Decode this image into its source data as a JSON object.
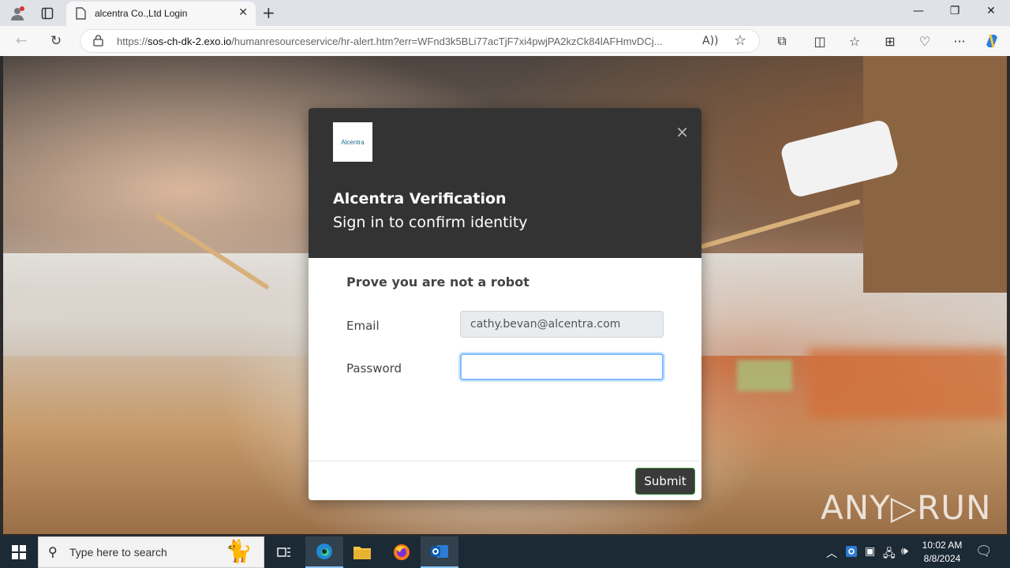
{
  "browser": {
    "tab_title": "alcentra Co.,Ltd Login",
    "url_scheme": "https://",
    "url_host": "sos-ch-dk-2.exo.io",
    "url_path": "/humanresourceservice/hr-alert.htm?err=WFnd3k5BLi77acTjF7xi4pwjPA2kzCk84lAFHmvDCj..."
  },
  "modal": {
    "logo_text": "Alcentra",
    "title": "Alcentra Verification",
    "subtitle": "Sign in to confirm identity",
    "prompt": "Prove you are not a robot",
    "email_label": "Email",
    "email_value": "cathy.bevan@alcentra.com",
    "password_label": "Password",
    "password_value": "",
    "submit_label": "Submit",
    "close_glyph": "×"
  },
  "watermark": "ANY▷RUN",
  "taskbar": {
    "search_placeholder": "Type here to search",
    "time": "10:02 AM",
    "date": "8/8/2024"
  },
  "colors": {
    "modal_header": "#333333",
    "input_focus_border": "#80bdff",
    "submit_bg": "#3a3a3a"
  }
}
